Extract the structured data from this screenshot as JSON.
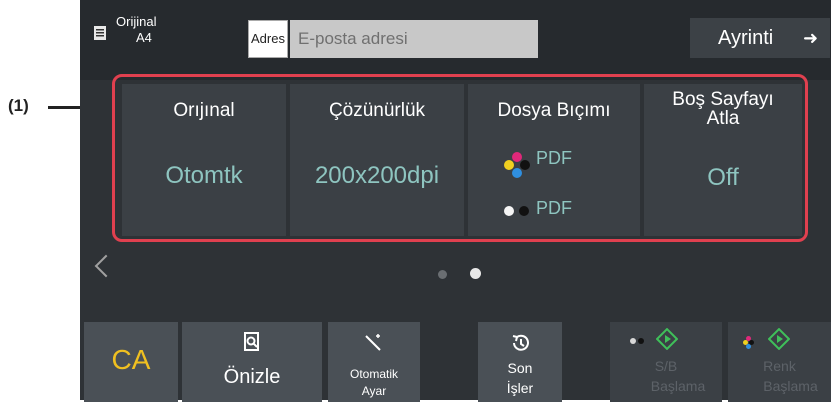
{
  "callout": "(1)",
  "header": {
    "original_label": "Orijinal",
    "paper_size": "A4",
    "address_label": "Adres",
    "address_placeholder": "E-posta adresi",
    "detail_label": "Ayrinti"
  },
  "settings": [
    {
      "title": "Orıjınal",
      "value": "Otomtk"
    },
    {
      "title": "Çözünürlük",
      "value": "200x200dpi"
    },
    {
      "title": "Dosya Bıçımı",
      "formats": [
        "PDF",
        "PDF"
      ]
    },
    {
      "title_line1": "Boş Sayfayı",
      "title_line2": "Atla",
      "value": "Off"
    }
  ],
  "pagination": {
    "total": 2,
    "current": 2
  },
  "footer": {
    "ca": "CA",
    "preview": "Önizle",
    "auto_line1": "Otomatik",
    "auto_line2": "Ayar",
    "recent_line1": "Son",
    "recent_line2": "İşler",
    "bw_line1": "S/B",
    "bw_line2": "Başlama",
    "color_line1": "Renk",
    "color_line2": "Başlama"
  },
  "colors": {
    "accent_value": "#8ec5c0",
    "highlight_frame": "#e0404f",
    "ca_text": "#f0c020",
    "start_icon": "#3fc05a"
  }
}
